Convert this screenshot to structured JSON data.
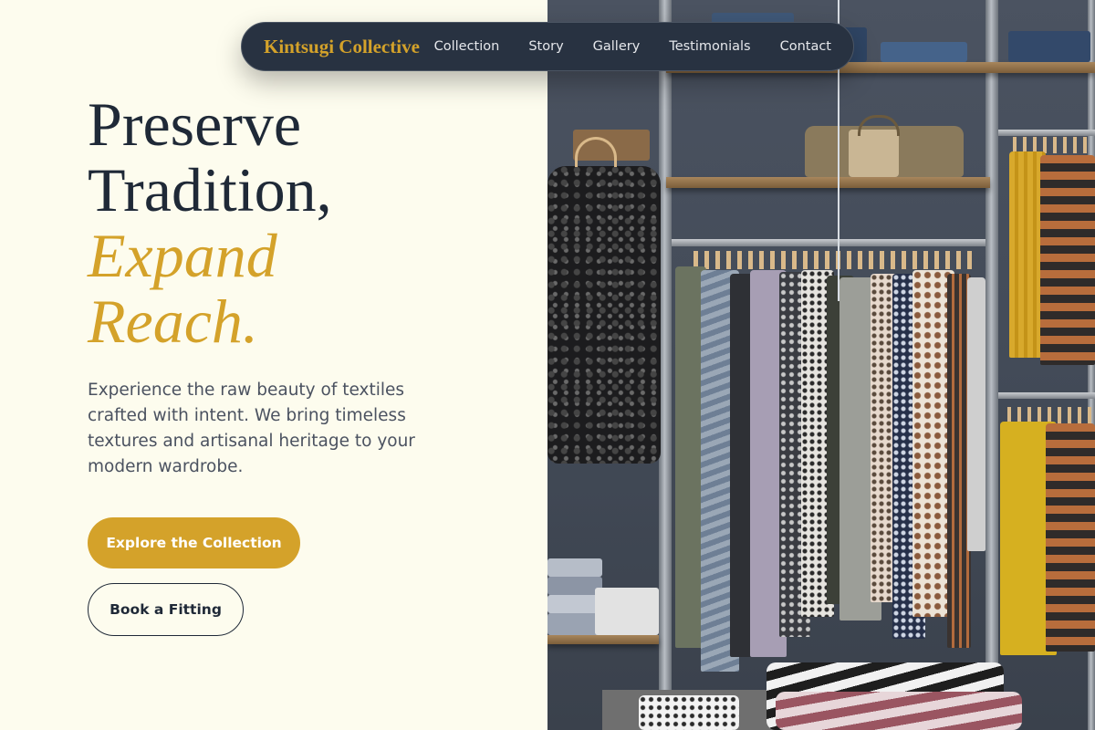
{
  "nav": {
    "brand": "Kintsugi Collective",
    "links": [
      "Collection",
      "Story",
      "Gallery",
      "Testimonials",
      "Contact"
    ]
  },
  "hero": {
    "headline_line1": "Preserve",
    "headline_line2": "Tradition,",
    "headline_accent_line1": "Expand",
    "headline_accent_line2": "Reach.",
    "lead": "Experience the raw beauty of textiles crafted with intent. We bring timeless textures and artisanal heritage to your modern wardrobe.",
    "primary_cta": "Explore the Collection",
    "secondary_cta": "Book a Fitting",
    "image_description_icon": "clothing-rack-photo"
  },
  "colors": {
    "background": "#fdfcee",
    "accent_gold": "#d4a22a",
    "navy": "#1f2937",
    "nav_background": "#283241",
    "body_text": "#4b5260"
  }
}
